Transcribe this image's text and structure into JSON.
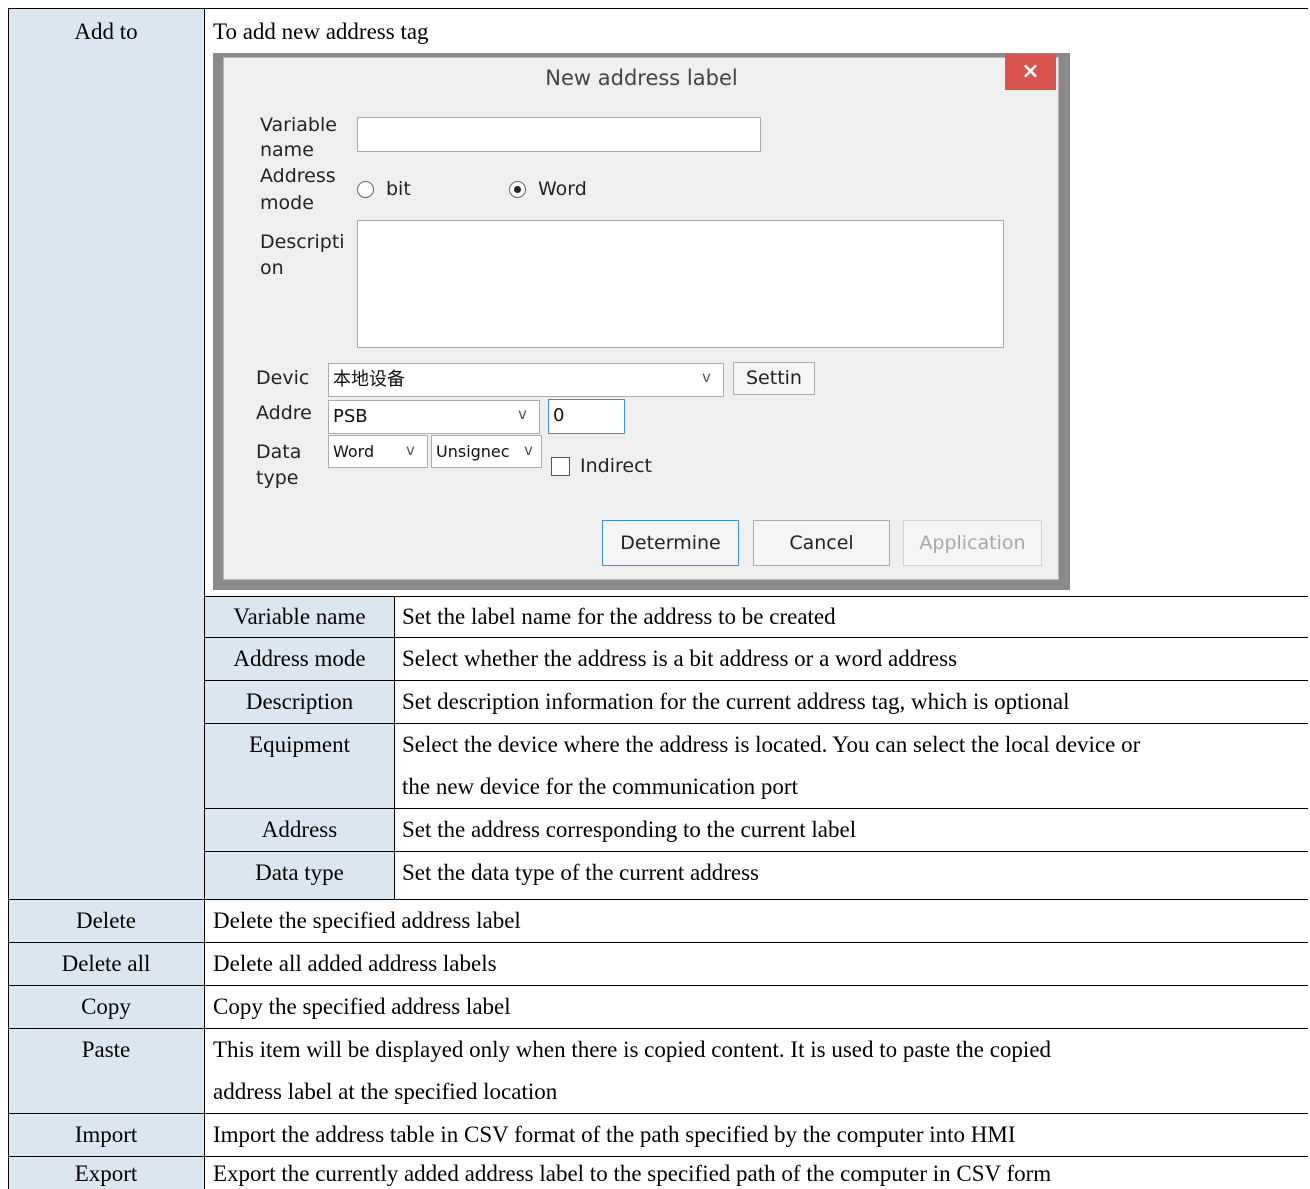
{
  "rows": {
    "add_to": {
      "label": "Add to",
      "desc": "To add new address tag",
      "dialog": {
        "title": "New address label",
        "close": "×",
        "variable_name_label_1": "Variable",
        "variable_name_label_2": "name",
        "address_mode_label_1": "Address",
        "address_mode_label_2": "mode",
        "radio_bit": "bit",
        "radio_word": "Word",
        "description_label_1": "Descripti",
        "description_label_2": "on",
        "device_label": "Devic",
        "device_value": "本地设备",
        "setting_button": "Settin",
        "address_label": "Addre",
        "address_type_value": "PSB",
        "address_value": "0",
        "data_type_label_1": "Data",
        "data_type_label_2": "type",
        "data_type_value": "Word",
        "sign_value": "Unsignec",
        "indirect_label": "Indirect",
        "determine_button": "Determine",
        "cancel_button": "Cancel",
        "application_button": "Application",
        "chevron": "v"
      },
      "sub": [
        {
          "name": "Variable name",
          "desc": "Set the label name for the address to be created"
        },
        {
          "name": "Address mode",
          "desc": "Select whether the address is a bit address or a word address"
        },
        {
          "name": "Description",
          "desc": "Set description information for the current address tag, which is optional"
        },
        {
          "name": "Equipment",
          "desc": "Select the device where the address is located. You can select the local device or",
          "desc2": "the new device for the communication port"
        },
        {
          "name": "Address",
          "desc": "Set the address corresponding to the current label"
        },
        {
          "name": "Data type",
          "desc": "Set the data type of the current address"
        }
      ]
    },
    "others": [
      {
        "label": "Delete",
        "desc": "Delete the specified address label"
      },
      {
        "label": "Delete all",
        "desc": "Delete all added address labels"
      },
      {
        "label": "Copy",
        "desc": "Copy the specified address label"
      },
      {
        "label": "Paste",
        "desc": "This item will be displayed only when there is copied content. It is used to paste the copied",
        "desc2": "address label at the specified location"
      },
      {
        "label": "Import",
        "desc": "Import the address table in CSV format of the path specified by the computer into HMI"
      },
      {
        "label": "Export",
        "desc": "Export the currently added address label to the specified path of the computer in CSV form"
      }
    ]
  },
  "colors": {
    "header_bg": "#dce6f1",
    "close_bg": "#d9534f"
  }
}
